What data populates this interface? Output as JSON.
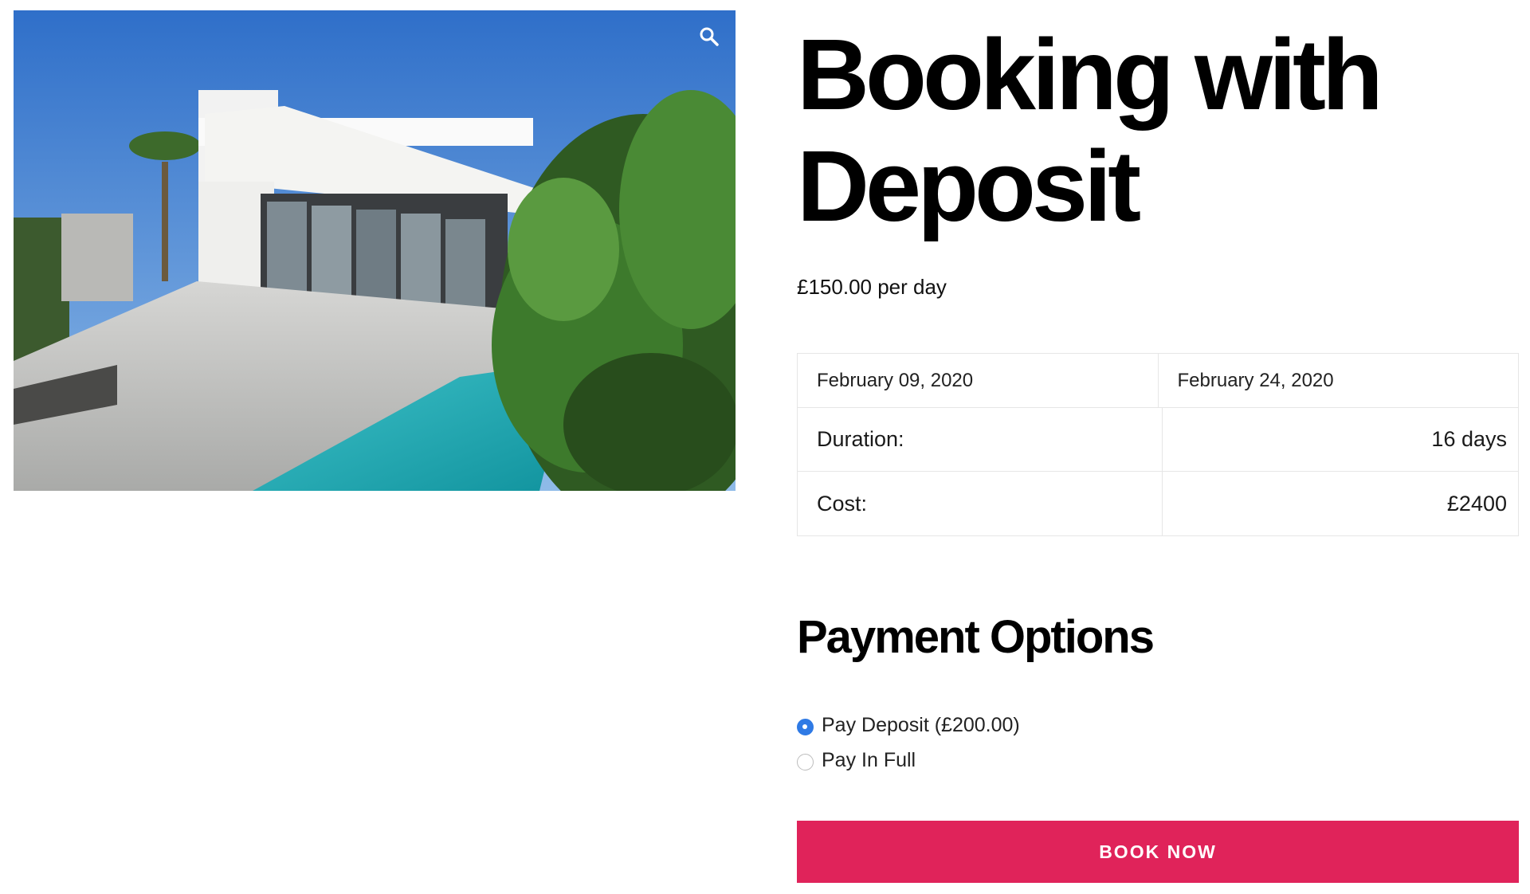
{
  "product": {
    "title": "Booking with Deposit",
    "price": "£150.00 per day",
    "image": {
      "alt": "modern white villa with pool"
    }
  },
  "booking": {
    "start_date": "February 09, 2020",
    "end_date": "February 24, 2020",
    "duration_label": "Duration:",
    "duration_value": "16 days",
    "cost_label": "Cost:",
    "cost_value": "£2400"
  },
  "payment": {
    "title": "Payment Options",
    "options": [
      {
        "label": "Pay Deposit (£200.00)",
        "selected": true
      },
      {
        "label": "Pay In Full",
        "selected": false
      }
    ]
  },
  "actions": {
    "book_label": "BOOK NOW"
  },
  "colors": {
    "button": "#e0235a",
    "radio_selected": "#2f7ae5",
    "text": "#111111"
  },
  "icons": {
    "zoom": "magnifier-icon"
  }
}
